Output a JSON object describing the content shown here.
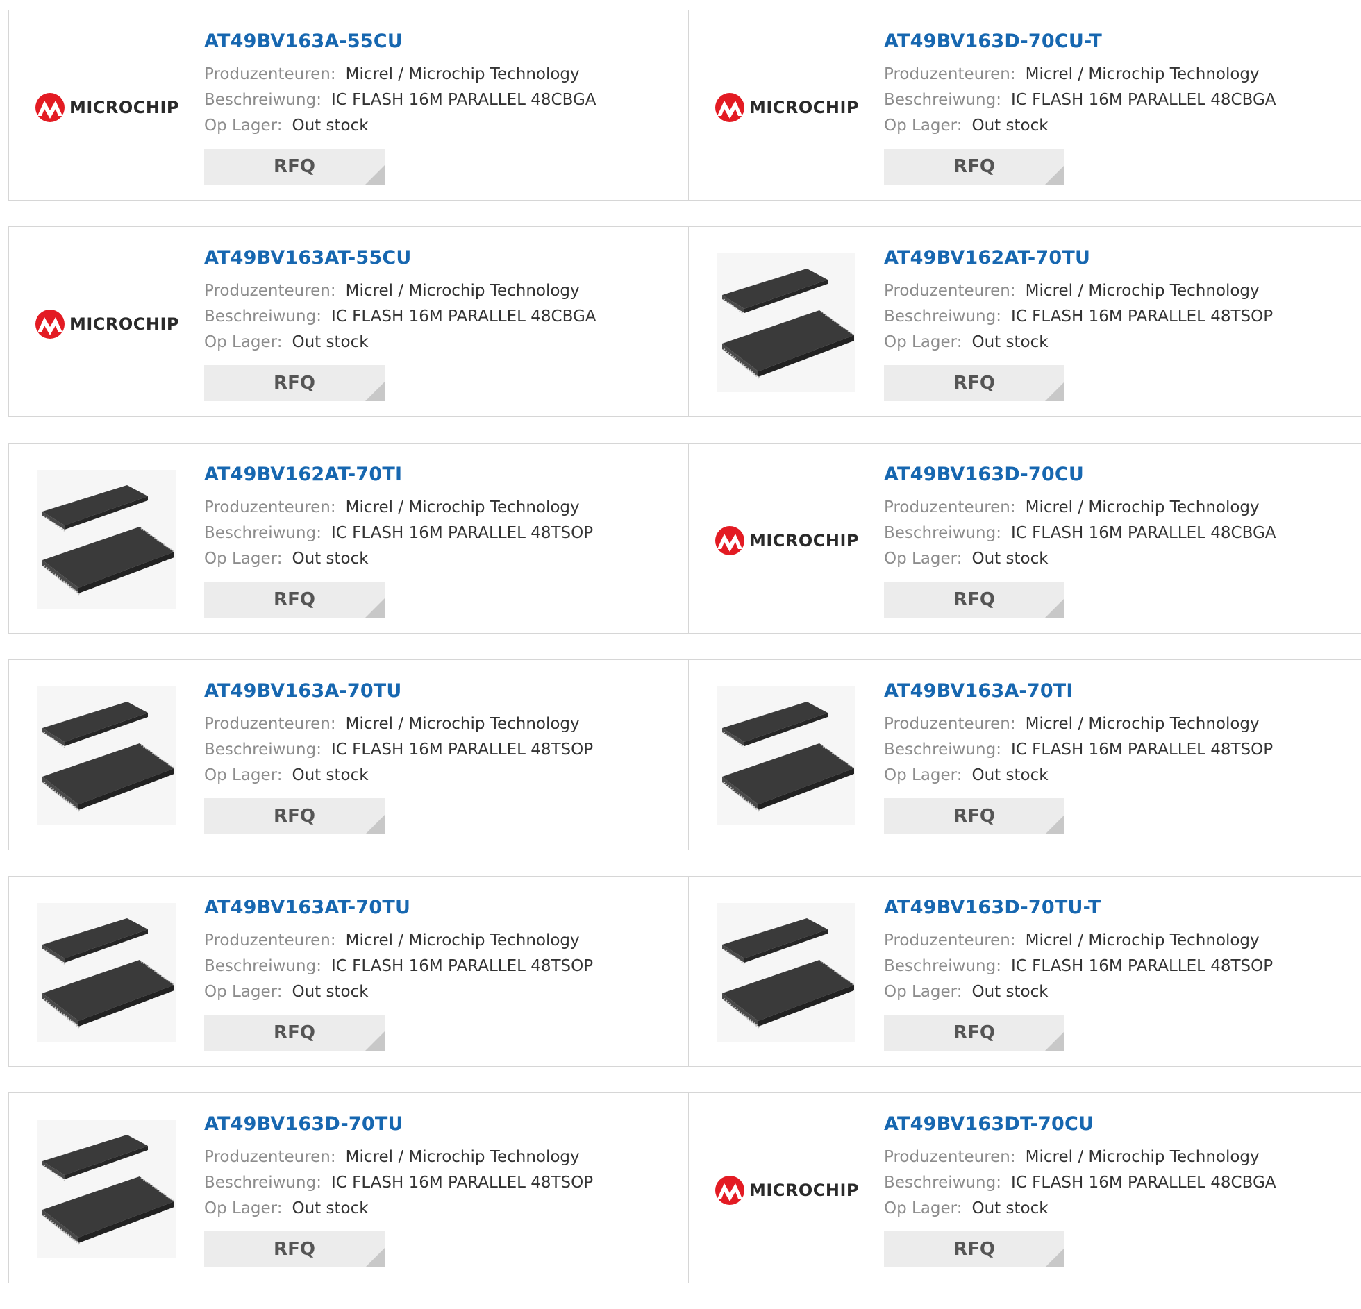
{
  "labels": {
    "manufacturer": "Produzenteuren:",
    "description": "Beschreiwung:",
    "stock": "Op Lager:",
    "rfq_button": "RFQ"
  },
  "brand": {
    "logo_text": "MICROCHIP",
    "logo_color": "#e31b23",
    "link_color": "#1767b0"
  },
  "products": [
    {
      "part_number": "AT49BV163A-55CU",
      "manufacturer": "Micrel / Microchip Technology",
      "description": "IC FLASH 16M PARALLEL 48CBGA",
      "stock": "Out stock",
      "image": "microchip-logo"
    },
    {
      "part_number": "AT49BV163D-70CU-T",
      "manufacturer": "Micrel / Microchip Technology",
      "description": "IC FLASH 16M PARALLEL 48CBGA",
      "stock": "Out stock",
      "image": "microchip-logo"
    },
    {
      "part_number": "AT49BV163AT-55CU",
      "manufacturer": "Micrel / Microchip Technology",
      "description": "IC FLASH 16M PARALLEL 48CBGA",
      "stock": "Out stock",
      "image": "microchip-logo"
    },
    {
      "part_number": "AT49BV162AT-70TU",
      "manufacturer": "Micrel / Microchip Technology",
      "description": "IC FLASH 16M PARALLEL 48TSOP",
      "stock": "Out stock",
      "image": "tsop-chip"
    },
    {
      "part_number": "AT49BV162AT-70TI",
      "manufacturer": "Micrel / Microchip Technology",
      "description": "IC FLASH 16M PARALLEL 48TSOP",
      "stock": "Out stock",
      "image": "tsop-chip"
    },
    {
      "part_number": "AT49BV163D-70CU",
      "manufacturer": "Micrel / Microchip Technology",
      "description": "IC FLASH 16M PARALLEL 48CBGA",
      "stock": "Out stock",
      "image": "microchip-logo"
    },
    {
      "part_number": "AT49BV163A-70TU",
      "manufacturer": "Micrel / Microchip Technology",
      "description": "IC FLASH 16M PARALLEL 48TSOP",
      "stock": "Out stock",
      "image": "tsop-chip"
    },
    {
      "part_number": "AT49BV163A-70TI",
      "manufacturer": "Micrel / Microchip Technology",
      "description": "IC FLASH 16M PARALLEL 48TSOP",
      "stock": "Out stock",
      "image": "tsop-chip"
    },
    {
      "part_number": "AT49BV163AT-70TU",
      "manufacturer": "Micrel / Microchip Technology",
      "description": "IC FLASH 16M PARALLEL 48TSOP",
      "stock": "Out stock",
      "image": "tsop-chip"
    },
    {
      "part_number": "AT49BV163D-70TU-T",
      "manufacturer": "Micrel / Microchip Technology",
      "description": "IC FLASH 16M PARALLEL 48TSOP",
      "stock": "Out stock",
      "image": "tsop-chip"
    },
    {
      "part_number": "AT49BV163D-70TU",
      "manufacturer": "Micrel / Microchip Technology",
      "description": "IC FLASH 16M PARALLEL 48TSOP",
      "stock": "Out stock",
      "image": "tsop-chip"
    },
    {
      "part_number": "AT49BV163DT-70CU",
      "manufacturer": "Micrel / Microchip Technology",
      "description": "IC FLASH 16M PARALLEL 48CBGA",
      "stock": "Out stock",
      "image": "microchip-logo"
    }
  ]
}
